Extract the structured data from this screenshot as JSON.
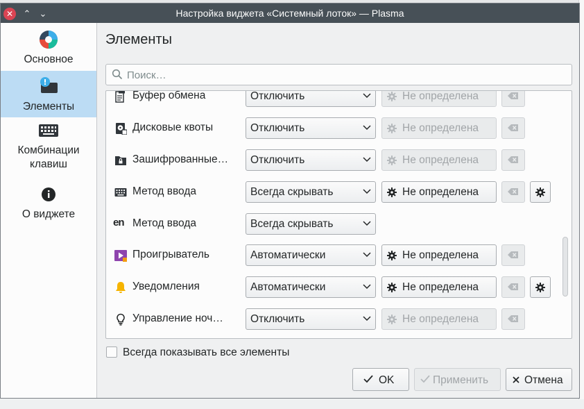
{
  "window": {
    "title": "Настройка виджета «Системный лоток» — Plasma",
    "close_glyph": "✕",
    "minimize_glyph": "⌃",
    "maximize_glyph": "⌄"
  },
  "sidebar": {
    "items": [
      {
        "label": "Основное",
        "icon": "general-icon",
        "active": false
      },
      {
        "label": "Элементы",
        "icon": "entries-icon",
        "active": true
      },
      {
        "label": "Комбинации клавиш",
        "label_line1": "Комбинации",
        "label_line2": "клавиш",
        "icon": "keyboard-icon",
        "active": false
      },
      {
        "label": "О виджете",
        "icon": "info-icon",
        "active": false
      }
    ]
  },
  "main": {
    "title": "Элементы",
    "search": {
      "placeholder": "Поиск…",
      "value": ""
    },
    "entries": [
      {
        "name": "Буфер обмена",
        "icon": "clipboard-icon",
        "visibility": "Отключить",
        "shortcut": "Не определена",
        "shortcut_enabled": false,
        "has_config": false
      },
      {
        "name": "Дисковые квоты",
        "icon": "disk-quota-icon",
        "visibility": "Отключить",
        "shortcut": "Не определена",
        "shortcut_enabled": false,
        "has_config": false
      },
      {
        "name": "Зашифрованные…",
        "icon": "encrypted-folder-icon",
        "visibility": "Отключить",
        "shortcut": "Не определена",
        "shortcut_enabled": false,
        "has_config": false
      },
      {
        "name": "Метод ввода",
        "icon": "keyboard-icon",
        "visibility": "Всегда скрывать",
        "shortcut": "Не определена",
        "shortcut_enabled": true,
        "has_config": true
      },
      {
        "name": "Метод ввода",
        "icon": "input-language-icon",
        "icon_text": "en",
        "visibility": "Всегда скрывать",
        "shortcut": null,
        "shortcut_enabled": false,
        "has_config": false
      },
      {
        "name": "Проигрыватель",
        "icon": "media-player-icon",
        "visibility": "Автоматически",
        "shortcut": "Не определена",
        "shortcut_enabled": true,
        "has_config": false
      },
      {
        "name": "Уведомления",
        "icon": "bell-icon",
        "visibility": "Автоматически",
        "shortcut": "Не определена",
        "shortcut_enabled": true,
        "has_config": true
      },
      {
        "name": "Управление ноч…",
        "icon": "night-color-icon",
        "visibility": "Отключить",
        "shortcut": "Не определена",
        "shortcut_enabled": false,
        "has_config": false
      }
    ],
    "show_all": {
      "label": "Всегда показывать все элементы",
      "checked": false
    }
  },
  "buttons": {
    "ok": {
      "label": "OK",
      "enabled": true
    },
    "apply": {
      "label": "Применить",
      "enabled": false
    },
    "cancel": {
      "label": "Отмена",
      "enabled": true
    }
  },
  "colors": {
    "titlebar": "#475057",
    "selection": "#bcdcf4",
    "close": "#da4453",
    "notification_bell": "#f6b400",
    "media_player": "#8e44ad"
  }
}
